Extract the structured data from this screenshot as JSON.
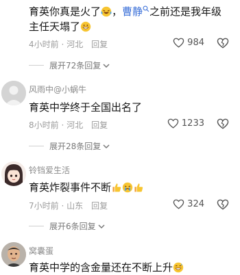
{
  "comments": [
    {
      "text_before": "育英你真是火了",
      "text_mid": "，",
      "mention": "曹静",
      "text_after": "之前还是我年级主任天塌了",
      "meta_time": "4小时前",
      "meta_location": "河北",
      "reply_label": "回复",
      "likes": "984",
      "expand_label": "展开72条回复"
    },
    {
      "username": "风雨中@小蜗牛",
      "text": "育英中学终于全国出名了",
      "meta_time": "8小时前",
      "meta_location": "河北",
      "reply_label": "回复",
      "likes": "1233",
      "expand_label": "展开28条回复"
    },
    {
      "username": "铃铛爱生活",
      "text": "育英炸裂事件不断",
      "meta_time": "7小时前",
      "meta_location": "山东",
      "reply_label": "回复",
      "likes": "324",
      "expand_label": "展开6条回复"
    },
    {
      "username": "窝囊蛋",
      "text": "育英中学的含金量还在不断上升"
    }
  ],
  "icons": {
    "like": "heart-outline-icon",
    "dislike": "broken-heart-icon",
    "expand": "chevron-down-icon",
    "search": "search-icon"
  },
  "colors": {
    "mention": "#3a6fd8",
    "meta": "#9b9b9b",
    "username": "#8a8a8a"
  }
}
